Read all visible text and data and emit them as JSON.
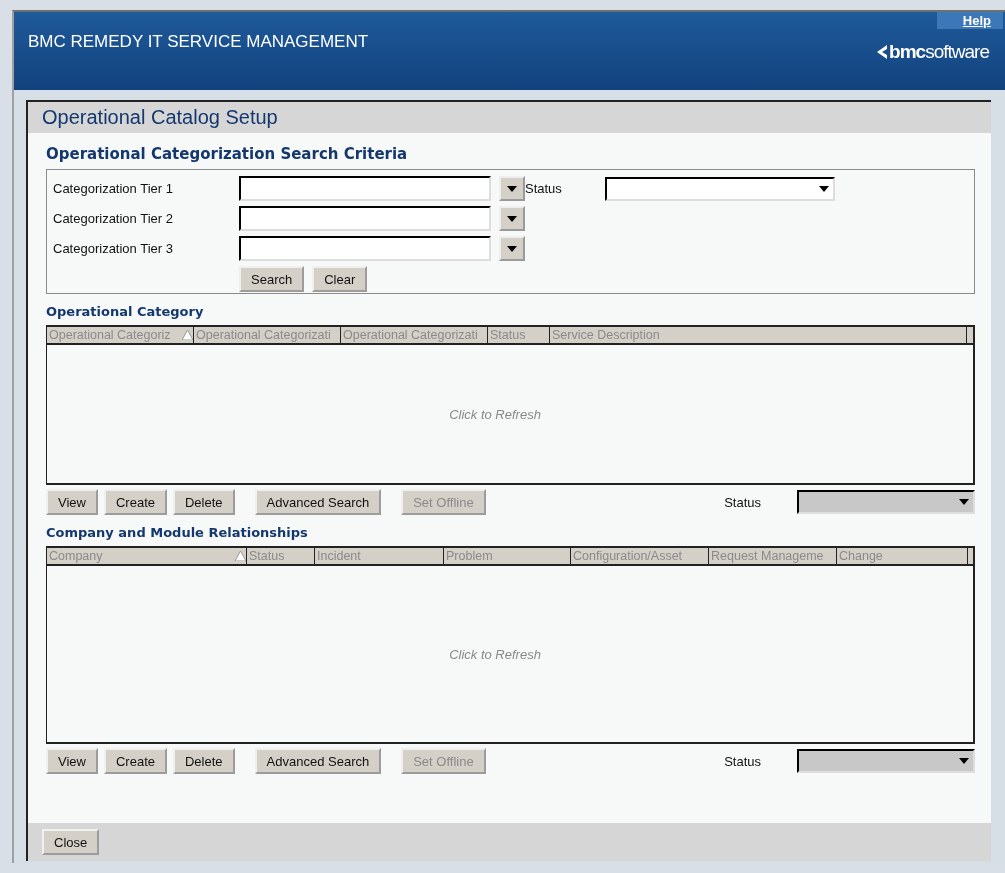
{
  "header": {
    "title": "BMC REMEDY IT SERVICE MANAGEMENT",
    "help_link": "Help",
    "logo": {
      "bold": "bmc",
      "light": "software"
    }
  },
  "form": {
    "title": "Operational Catalog Setup"
  },
  "search_criteria": {
    "title": "Operational Categorization Search Criteria",
    "fields": [
      {
        "label": "Categorization Tier 1"
      },
      {
        "label": "Categorization Tier 2"
      },
      {
        "label": "Categorization Tier 3"
      }
    ],
    "status": {
      "label": "Status",
      "disabled": false
    },
    "buttons": [
      {
        "label": "Search"
      },
      {
        "label": "Clear"
      }
    ]
  },
  "tables": [
    {
      "title": "Operational Category",
      "columns": [
        {
          "label": "Operational Categoriz",
          "sorted": true
        },
        {
          "label": "Operational Categorizati",
          "sorted": false
        },
        {
          "label": "Operational Categorizati",
          "sorted": false
        },
        {
          "label": "Status",
          "sorted": false
        },
        {
          "label": "Service Description",
          "sorted": false
        }
      ],
      "empty_message": "Click to Refresh",
      "buttons": [
        {
          "label": "View",
          "disabled": false
        },
        {
          "label": "Create",
          "disabled": false
        },
        {
          "label": "Delete",
          "disabled": false
        },
        {
          "label": "Advanced Search",
          "disabled": false
        },
        {
          "label": "Set Offline",
          "disabled": true
        }
      ],
      "status": {
        "label": "Status",
        "disabled": true
      }
    },
    {
      "title": "Company and Module Relationships",
      "columns": [
        {
          "label": "Company",
          "sorted": true
        },
        {
          "label": "Status",
          "sorted": false
        },
        {
          "label": "Incident",
          "sorted": false
        },
        {
          "label": "Problem",
          "sorted": false
        },
        {
          "label": "Configuration/Asset",
          "sorted": false
        },
        {
          "label": "Request Manageme",
          "sorted": false
        },
        {
          "label": "Change",
          "sorted": false
        }
      ],
      "empty_message": "Click to Refresh",
      "buttons": [
        {
          "label": "View",
          "disabled": false
        },
        {
          "label": "Create",
          "disabled": false
        },
        {
          "label": "Delete",
          "disabled": false
        },
        {
          "label": "Advanced Search",
          "disabled": false
        },
        {
          "label": "Set Offline",
          "disabled": true
        }
      ],
      "status": {
        "label": "Status",
        "disabled": true
      }
    }
  ],
  "footer": {
    "buttons": [
      {
        "label": "Close"
      }
    ]
  }
}
